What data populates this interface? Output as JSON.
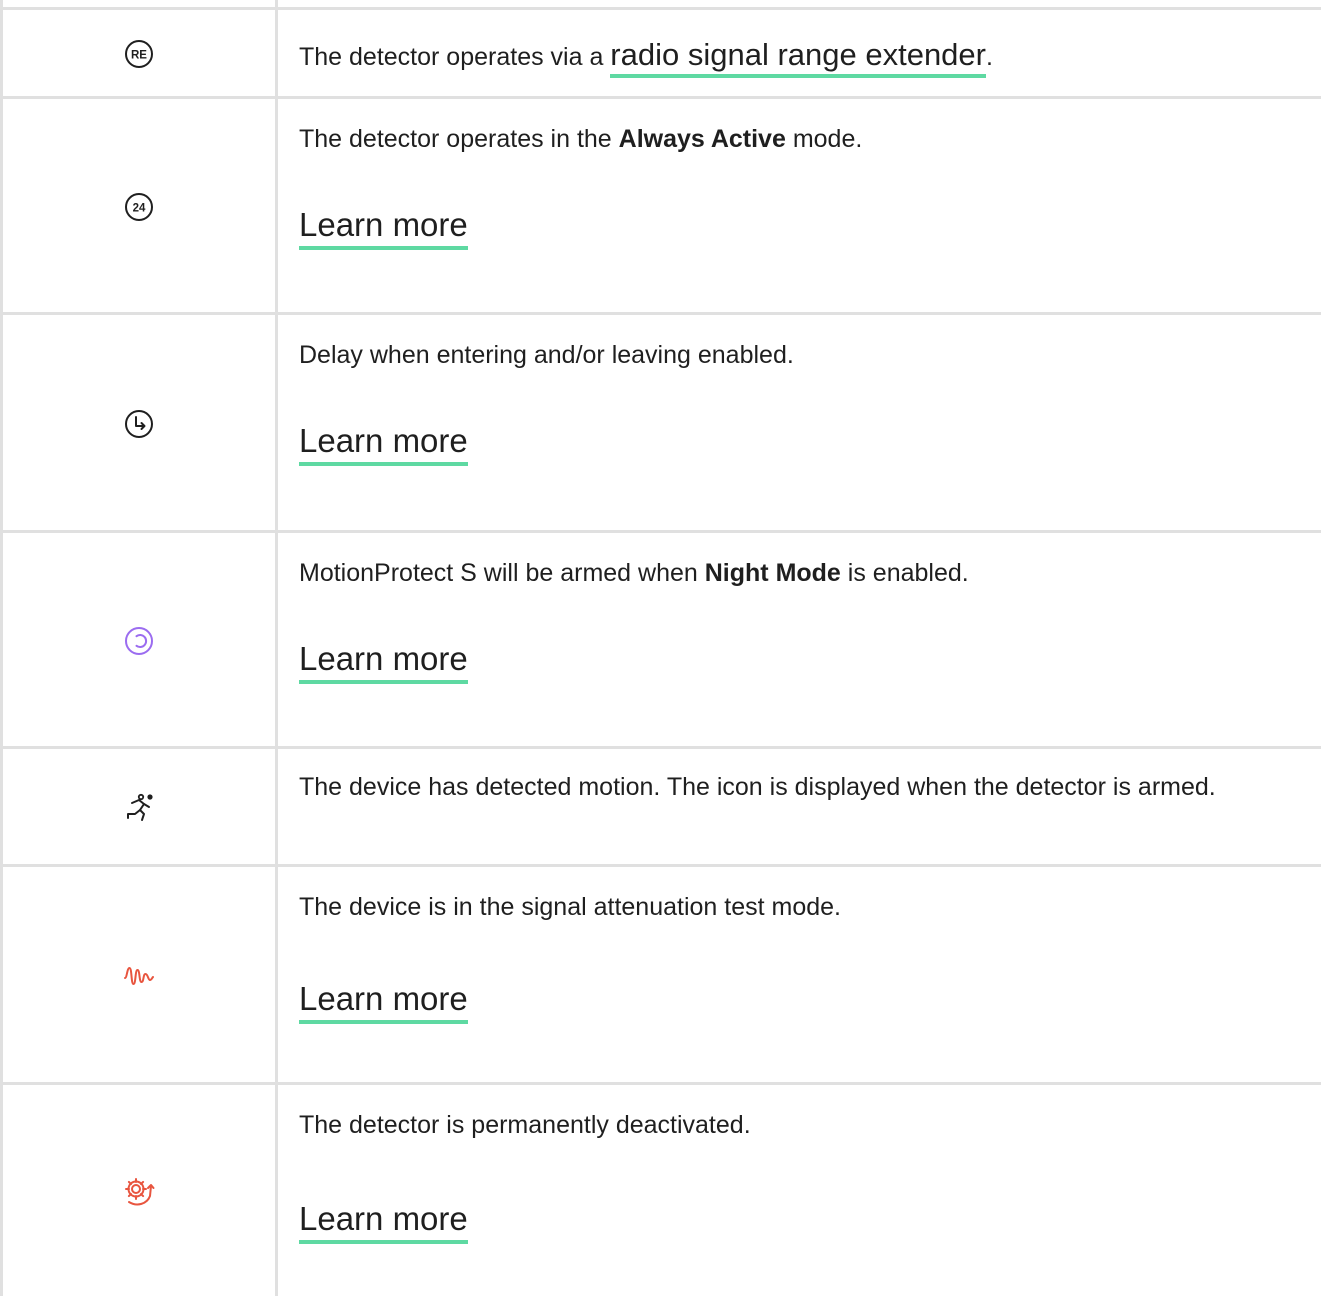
{
  "colors": {
    "border": "#e0e0e0",
    "link_underline": "#5ed9a2",
    "night_mode_icon": "#9b6cf0",
    "alert_icon": "#e8553f",
    "text": "#1f1f1f"
  },
  "rows": [
    {
      "icon": "range-extender-icon",
      "icon_text": "RE",
      "text_before": "The detector operates via a ",
      "link": "radio signal range extender",
      "text_after": "."
    },
    {
      "icon": "always-active-icon",
      "icon_text": "24",
      "text_before": "The detector operates in the ",
      "bold": "Always Active",
      "text_after": " mode.",
      "link": "Learn more"
    },
    {
      "icon": "delay-clock-icon",
      "text": "Delay when entering and/or leaving enabled.",
      "link": "Learn more"
    },
    {
      "icon": "night-mode-icon",
      "text_before": "MotionProtect S will be armed when ",
      "bold": "Night Mode",
      "text_after": " is enabled.",
      "link": "Learn more"
    },
    {
      "icon": "motion-detected-icon",
      "text": "The device has detected motion. The icon is displayed when the detector is armed."
    },
    {
      "icon": "signal-attenuation-icon",
      "text": "The device is in the signal attenuation test mode.",
      "link": "Learn more"
    },
    {
      "icon": "permanently-deactivated-icon",
      "text": "The detector is permanently deactivated.",
      "link": "Learn more"
    }
  ]
}
